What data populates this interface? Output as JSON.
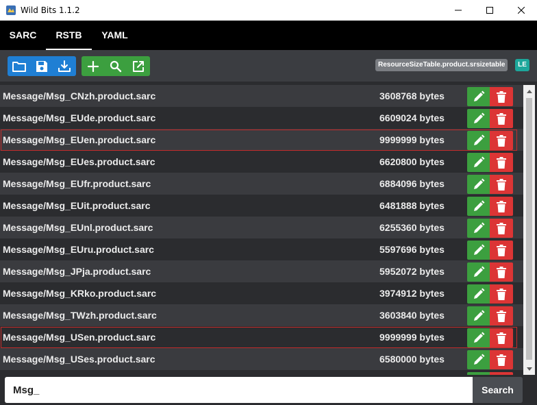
{
  "window": {
    "title": "Wild Bits 1.1.2"
  },
  "tabs": [
    {
      "label": "SARC",
      "active": false
    },
    {
      "label": "RSTB",
      "active": true
    },
    {
      "label": "YAML",
      "active": false
    }
  ],
  "toolbar": {
    "blue_icons": [
      "folder-open-icon",
      "save-icon",
      "download-icon"
    ],
    "green_icons": [
      "plus-icon",
      "search-icon",
      "external-link-icon"
    ],
    "file_name": "ResourceSizeTable.product.srsizetable",
    "endian": "LE"
  },
  "entries": [
    {
      "name": "Message/Msg_CNzh.product.sarc",
      "size": "3608768 bytes",
      "modified": false
    },
    {
      "name": "Message/Msg_EUde.product.sarc",
      "size": "6609024 bytes",
      "modified": false
    },
    {
      "name": "Message/Msg_EUen.product.sarc",
      "size": "9999999 bytes",
      "modified": true
    },
    {
      "name": "Message/Msg_EUes.product.sarc",
      "size": "6620800 bytes",
      "modified": false
    },
    {
      "name": "Message/Msg_EUfr.product.sarc",
      "size": "6884096 bytes",
      "modified": false
    },
    {
      "name": "Message/Msg_EUit.product.sarc",
      "size": "6481888 bytes",
      "modified": false
    },
    {
      "name": "Message/Msg_EUnl.product.sarc",
      "size": "6255360 bytes",
      "modified": false
    },
    {
      "name": "Message/Msg_EUru.product.sarc",
      "size": "5597696 bytes",
      "modified": false
    },
    {
      "name": "Message/Msg_JPja.product.sarc",
      "size": "5952072 bytes",
      "modified": false
    },
    {
      "name": "Message/Msg_KRko.product.sarc",
      "size": "3974912 bytes",
      "modified": false
    },
    {
      "name": "Message/Msg_TWzh.product.sarc",
      "size": "3603840 bytes",
      "modified": false
    },
    {
      "name": "Message/Msg_USen.product.sarc",
      "size": "9999999 bytes",
      "modified": true
    },
    {
      "name": "Message/Msg_USes.product.sarc",
      "size": "6580000 bytes",
      "modified": false
    }
  ],
  "search": {
    "value": "Msg_",
    "button_label": "Search"
  },
  "colors": {
    "primary": "#1f7fd4",
    "success": "#3c9f3f",
    "danger": "#dc3535",
    "highlight_border": "#c42b2b",
    "badge_gray": "#7a7d82",
    "badge_teal": "#1da79b"
  }
}
